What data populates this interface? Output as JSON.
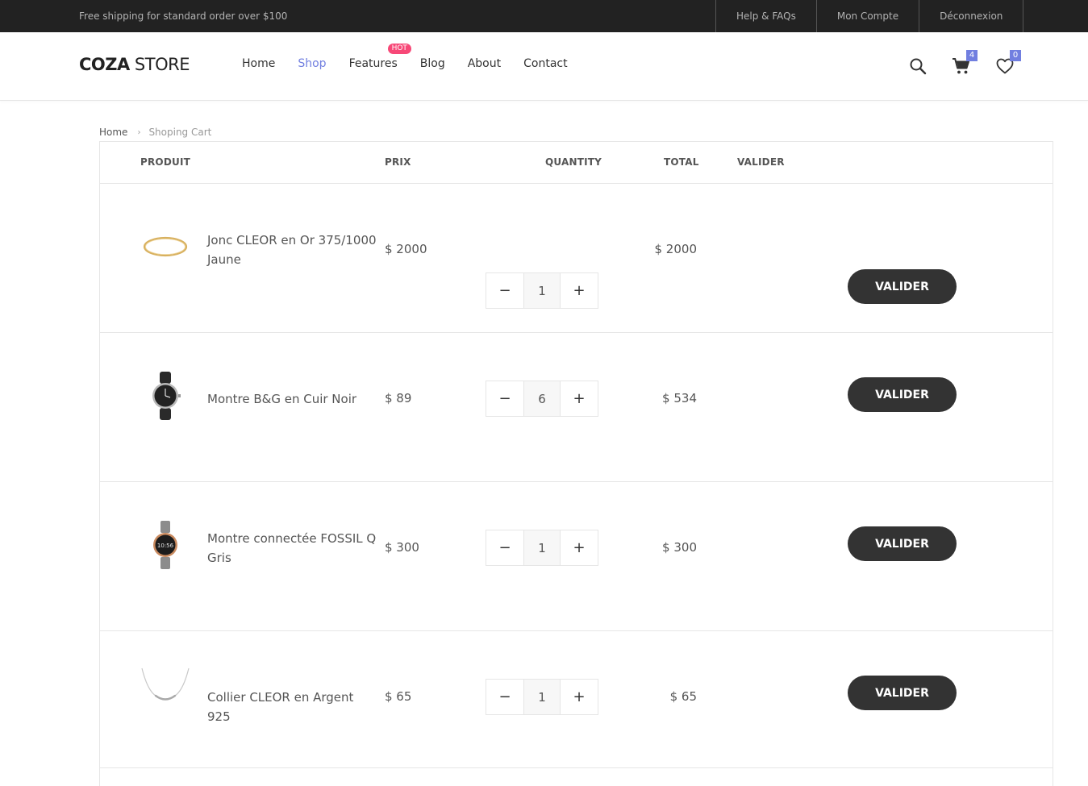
{
  "topbar": {
    "promo": "Free shipping for standard order over $100",
    "links": [
      "Help & FAQs",
      "Mon Compte",
      "Déconnexion"
    ]
  },
  "header": {
    "logo_bold": "COZA",
    "logo_light": " STORE",
    "nav": [
      "Home",
      "Shop",
      "Features",
      "Blog",
      "About",
      "Contact"
    ],
    "active_nav": "Shop",
    "hot_label": "HOT",
    "cart_count": "4",
    "wishlist_count": "0",
    "accent_color": "#717fe0",
    "hot_color": "#f74877"
  },
  "breadcrumb": {
    "home": "Home",
    "current": "Shoping Cart"
  },
  "table": {
    "headers": {
      "product": "PRODUIT",
      "price": "PRIX",
      "quantity": "QUANTITY",
      "total": "TOTAL",
      "validate": "VALIDER"
    },
    "rows": [
      {
        "image": "gold-bangle-image",
        "name": "Jonc CLEOR en Or 375/1000 Jaune",
        "price": "$ 2000",
        "quantity": "1",
        "total": "$ 2000",
        "button": "VALIDER"
      },
      {
        "image": "leather-watch-image",
        "name": "Montre B&G en Cuir Noir",
        "price": "$ 89",
        "quantity": "6",
        "total": "$ 534",
        "button": "VALIDER"
      },
      {
        "image": "smartwatch-image",
        "name": "Montre connectée FOSSIL Q Gris",
        "price": "$ 300",
        "quantity": "1",
        "total": "$ 300",
        "button": "VALIDER"
      },
      {
        "image": "silver-necklace-image",
        "name": "Collier CLEOR en Argent 925",
        "price": "$ 65",
        "quantity": "1",
        "total": "$ 65",
        "button": "VALIDER"
      }
    ],
    "minus_symbol": "−",
    "plus_symbol": "+",
    "button_color": "#333333"
  }
}
